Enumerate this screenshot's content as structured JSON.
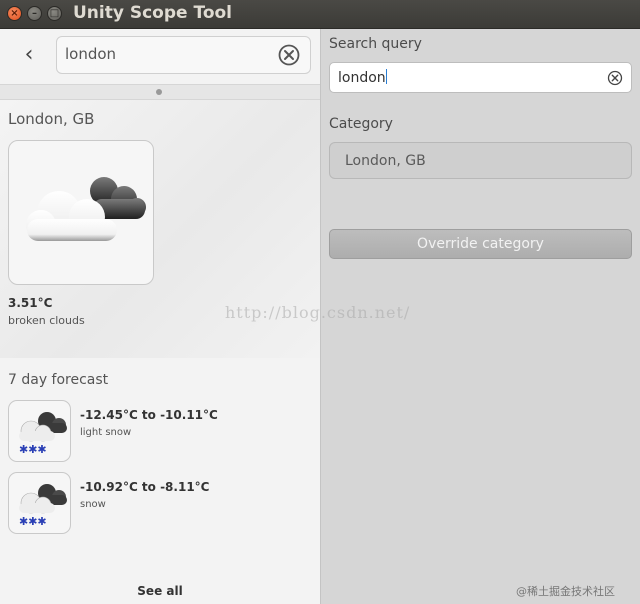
{
  "window": {
    "title": "Unity Scope Tool",
    "close_glyph": "×",
    "min_glyph": "–",
    "max_glyph": "□"
  },
  "preview": {
    "back_glyph": "‹",
    "search_value": "london",
    "current": {
      "location": "London, GB",
      "icon": "broken-clouds-icon",
      "temperature": "3.51°C",
      "description": "broken clouds"
    },
    "forecast": {
      "title": "7 day forecast",
      "items": [
        {
          "range": "-12.45°C to -10.11°C",
          "description": "light snow",
          "icon": "snow-icon"
        },
        {
          "range": "-10.92°C to -8.11°C",
          "description": "snow",
          "icon": "snow-icon"
        }
      ],
      "see_all": "See all"
    }
  },
  "tool": {
    "query_label": "Search query",
    "query_value": "london",
    "category_label": "Category",
    "category_value": "London, GB",
    "override_label": "Override category"
  },
  "overlay": {
    "watermark": "http://blog.csdn.net/",
    "corner": "@稀土掘金技术社区"
  },
  "colors": {
    "titlebar": "#3c3b37",
    "close_button": "#e0501f",
    "caret": "#2a7fd4"
  }
}
